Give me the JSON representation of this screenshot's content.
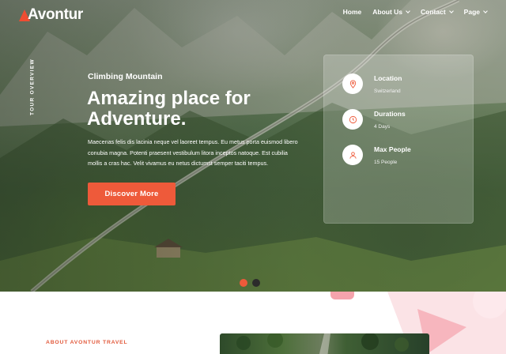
{
  "brand": {
    "name": "Avontur",
    "accent": "#ee5a3a"
  },
  "nav": {
    "items": [
      {
        "label": "Home",
        "has_dropdown": false
      },
      {
        "label": "About Us",
        "has_dropdown": true
      },
      {
        "label": "Contact",
        "has_dropdown": true
      },
      {
        "label": "Page",
        "has_dropdown": true
      }
    ]
  },
  "hero": {
    "side_label": "TOUR OVERVIEW",
    "eyebrow": "Climbing Mountain",
    "title": "Amazing place for Adventure.",
    "description": "Maecenas felis dis lacinia neque vel laoreet tempus. Eu metus porta euismod libero conubia magna. Potenti praesent vestibulum litora inceptos natoque. Est cubilia mollis a cras hac. Velit vivamus eu netus dictumst semper taciti tempus.",
    "cta_label": "Discover More"
  },
  "info_card": {
    "items": [
      {
        "label": "Location",
        "value": "Switzerland",
        "icon": "map-pin-icon"
      },
      {
        "label": "Durations",
        "value": "4 Days",
        "icon": "clock-icon"
      },
      {
        "label": "Max People",
        "value": "15 People",
        "icon": "user-icon"
      }
    ]
  },
  "slider": {
    "total": 2,
    "active": 1
  },
  "about": {
    "label": "ABOUT AVONTUR TRAVEL"
  }
}
